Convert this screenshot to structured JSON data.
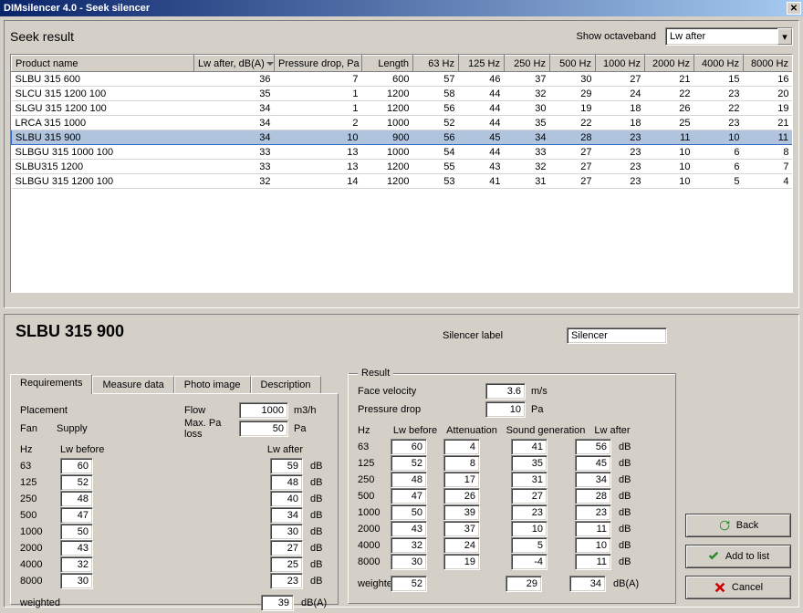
{
  "window": {
    "title": "DIMsilencer 4.0  -   Seek silencer"
  },
  "top": {
    "heading": "Seek result",
    "octave_label": "Show octaveband",
    "octave_value": "Lw after"
  },
  "grid": {
    "headers": [
      "Product name",
      "Lw after, dB(A)",
      "Pressure drop, Pa",
      "Length",
      "63 Hz",
      "125 Hz",
      "250 Hz",
      "500 Hz",
      "1000 Hz",
      "2000 Hz",
      "4000 Hz",
      "8000 Hz"
    ],
    "sort_col": 1,
    "selected_index": 4,
    "rows": [
      [
        "SLBU 315 600",
        36,
        7,
        600,
        57,
        46,
        37,
        30,
        27,
        21,
        15,
        16
      ],
      [
        "SLCU 315 1200 100",
        35,
        1,
        1200,
        58,
        44,
        32,
        29,
        24,
        22,
        23,
        20
      ],
      [
        "SLGU 315 1200 100",
        34,
        1,
        1200,
        56,
        44,
        30,
        19,
        18,
        26,
        22,
        19
      ],
      [
        "LRCA 315 1000",
        34,
        2,
        1000,
        52,
        44,
        35,
        22,
        18,
        25,
        23,
        21
      ],
      [
        "SLBU 315 900",
        34,
        10,
        900,
        56,
        45,
        34,
        28,
        23,
        11,
        10,
        11
      ],
      [
        "SLBGU 315 1000 100",
        33,
        13,
        1000,
        54,
        44,
        33,
        27,
        23,
        10,
        6,
        8
      ],
      [
        "SLBU315 1200",
        33,
        13,
        1200,
        55,
        43,
        32,
        27,
        23,
        10,
        6,
        7
      ],
      [
        "SLBGU 315 1200 100",
        32,
        14,
        1200,
        53,
        41,
        31,
        27,
        23,
        10,
        5,
        4
      ]
    ]
  },
  "detail": {
    "title": "SLBU 315 900",
    "silencer_label_text": "Silencer label",
    "silencer_label_value": "Silencer",
    "tabs": [
      "Requirements",
      "Measure data",
      "Photo image",
      "Description"
    ],
    "active_tab": 0,
    "req": {
      "placement_label": "Placement",
      "flow_label": "Flow",
      "flow_value": "1000",
      "flow_unit": "m3/h",
      "fan_label": "Fan",
      "supply_label": "Supply",
      "max_pa_label": "Max. Pa loss",
      "max_pa_value": "50",
      "max_pa_unit": "Pa",
      "col_hz": "Hz",
      "col_before": "Lw before",
      "col_after": "Lw after",
      "weighted_label": "weighted",
      "weighted_after": "39",
      "weighted_unit": "dB(A)",
      "freqs": [
        "63",
        "125",
        "250",
        "500",
        "1000",
        "2000",
        "4000",
        "8000"
      ],
      "before": [
        "60",
        "52",
        "48",
        "47",
        "50",
        "43",
        "32",
        "30"
      ],
      "after": [
        "59",
        "48",
        "40",
        "34",
        "30",
        "27",
        "25",
        "23"
      ],
      "unit": "dB"
    },
    "result": {
      "title": "Result",
      "face_vel_label": "Face velocity",
      "face_vel_value": "3.6",
      "face_vel_unit": "m/s",
      "pdrop_label": "Pressure drop",
      "pdrop_value": "10",
      "pdrop_unit": "Pa",
      "col_hz": "Hz",
      "col_before": "Lw before",
      "col_atten": "Attenuation",
      "col_gen": "Sound generation",
      "col_after": "Lw after",
      "freqs": [
        "63",
        "125",
        "250",
        "500",
        "1000",
        "2000",
        "4000",
        "8000"
      ],
      "before": [
        "60",
        "52",
        "48",
        "47",
        "50",
        "43",
        "32",
        "30"
      ],
      "atten": [
        "4",
        "8",
        "17",
        "26",
        "39",
        "37",
        "24",
        "19"
      ],
      "gen": [
        "41",
        "35",
        "31",
        "27",
        "23",
        "10",
        "5",
        "-4"
      ],
      "after": [
        "56",
        "45",
        "34",
        "28",
        "23",
        "11",
        "10",
        "11"
      ],
      "unit": "dB",
      "weighted_label": "weighted",
      "w_before": "52",
      "w_gen": "29",
      "w_after": "34",
      "w_unit": "dB(A)"
    }
  },
  "buttons": {
    "back": "Back",
    "add": "Add to list",
    "cancel": "Cancel"
  }
}
